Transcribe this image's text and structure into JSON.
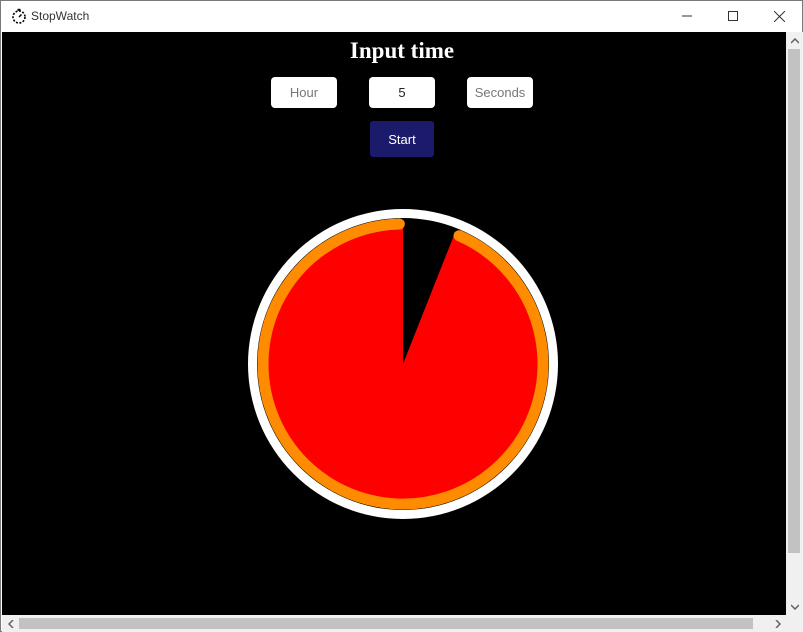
{
  "window": {
    "title": "StopWatch",
    "icon": "stopwatch-app-icon",
    "controls": [
      "minimize-icon",
      "maximize-icon",
      "close-icon"
    ]
  },
  "main": {
    "heading": "Input time",
    "fields": {
      "hour": {
        "value": "",
        "placeholder": "Hour"
      },
      "minutes": {
        "value": "5",
        "placeholder": ""
      },
      "seconds": {
        "value": "",
        "placeholder": "Seconds"
      }
    },
    "start_label": "Start"
  },
  "timer": {
    "elapsed_fraction": 0.06,
    "colors": {
      "background": "#000000",
      "outer_ring": "#ffffff",
      "progress_ring": "#ff8c00",
      "fill": "#ff0000",
      "button": "#1c1a6b"
    }
  }
}
